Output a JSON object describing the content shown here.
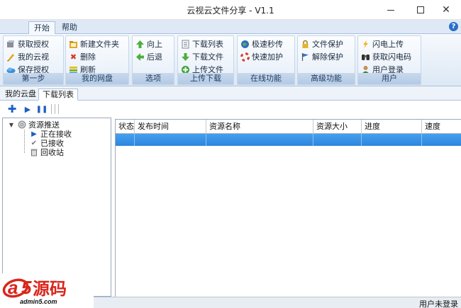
{
  "window": {
    "title": "云视云文件分享 - V1.1",
    "controls": [
      "minimize",
      "maximize",
      "close"
    ]
  },
  "menu": {
    "tabs": [
      "开始",
      "帮助"
    ],
    "active": "开始",
    "help_icon": "?"
  },
  "ribbon": {
    "groups": [
      {
        "label": "第一步",
        "items": [
          {
            "label": "获取授权",
            "icon": "key-icon"
          },
          {
            "label": "我的云视",
            "icon": "pen-icon"
          },
          {
            "label": "保存授权",
            "icon": "cloud-icon"
          }
        ]
      },
      {
        "label": "我的网盘",
        "items": [
          {
            "label": "新建文件夹",
            "icon": "new-folder-icon"
          },
          {
            "label": "删除",
            "icon": "delete-icon"
          },
          {
            "label": "刷新",
            "icon": "refresh-icon"
          }
        ]
      },
      {
        "label": "选项",
        "items": [
          {
            "label": "向上",
            "icon": "arrow-up-icon"
          },
          {
            "label": "后退",
            "icon": "arrow-left-icon"
          }
        ]
      },
      {
        "label": "上传下载",
        "items": [
          {
            "label": "下载列表",
            "icon": "list-icon"
          },
          {
            "label": "下载文件",
            "icon": "download-icon"
          },
          {
            "label": "上传文件",
            "icon": "upload-icon"
          }
        ]
      },
      {
        "label": "在线功能",
        "items": [
          {
            "label": "极速秒传",
            "icon": "globe-icon"
          },
          {
            "label": "快速加护",
            "icon": "lifebuoy-icon"
          }
        ]
      },
      {
        "label": "高级功能",
        "items": [
          {
            "label": "文件保护",
            "icon": "lock-icon"
          },
          {
            "label": "解除保护",
            "icon": "flag-icon"
          }
        ]
      },
      {
        "label": "用户",
        "items": [
          {
            "label": "闪电上传",
            "icon": "lightning-icon"
          },
          {
            "label": "获取闪电码",
            "icon": "binoculars-icon"
          },
          {
            "label": "用户登录",
            "icon": "user-icon"
          }
        ]
      }
    ]
  },
  "doc_tabs": [
    "我的云盘",
    "下载列表"
  ],
  "active_doc_tab": "下载列表",
  "toolbar": {
    "buttons": [
      "add-icon",
      "play-icon",
      "pause-icon"
    ]
  },
  "tree": {
    "root": "资源推送",
    "children": [
      "正在接收",
      "已接收",
      "回收站"
    ]
  },
  "grid": {
    "columns": [
      "状态",
      "发布时间",
      "资源名称",
      "资源大小",
      "进度",
      "速度"
    ],
    "rows": [
      [
        "",
        "",
        "",
        "",
        "",
        ""
      ]
    ],
    "selected_row": 0
  },
  "status": {
    "text": "用户未登录"
  },
  "watermark": {
    "brand": "a5源码",
    "url": "admin5.com"
  },
  "colors": {
    "accent": "#2c86de",
    "ribbon_bg": "#dde8f5",
    "brand_red": "#d9261c"
  }
}
